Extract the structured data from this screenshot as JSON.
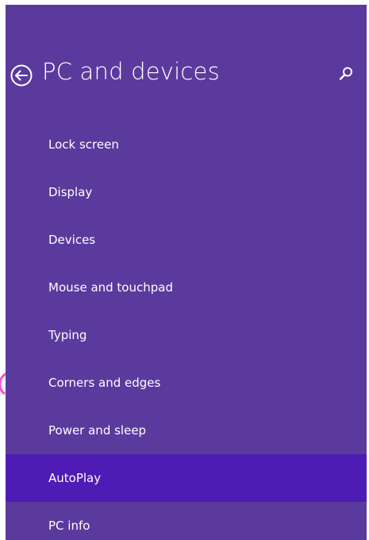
{
  "header": {
    "title": "PC and devices",
    "back_icon": "back-arrow-icon",
    "search_icon": "search-icon"
  },
  "nav": {
    "items": [
      {
        "label": "Lock screen",
        "selected": false
      },
      {
        "label": "Display",
        "selected": false
      },
      {
        "label": "Devices",
        "selected": false
      },
      {
        "label": "Mouse and touchpad",
        "selected": false
      },
      {
        "label": "Typing",
        "selected": false
      },
      {
        "label": "Corners and edges",
        "selected": false
      },
      {
        "label": "Power and sleep",
        "selected": false
      },
      {
        "label": "AutoPlay",
        "selected": true
      },
      {
        "label": "PC info",
        "selected": false
      }
    ]
  },
  "colors": {
    "panel_background": "#5b3a9e",
    "selected_background": "#4e1bb5",
    "text": "#ffffff",
    "edge_mark": "#ff4fc8"
  }
}
